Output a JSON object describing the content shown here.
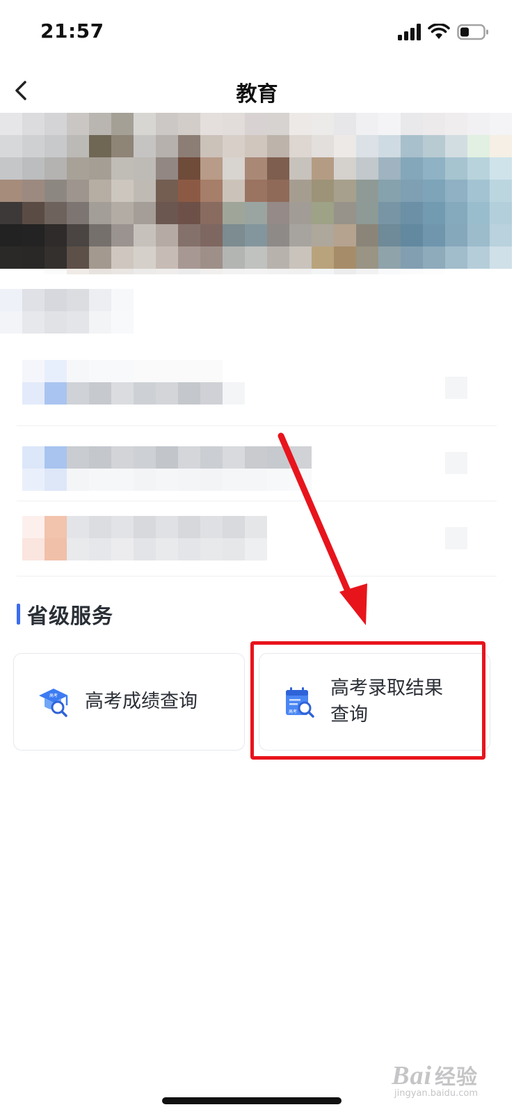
{
  "status_bar": {
    "time": "21:57",
    "icons": [
      "signal-icon",
      "wifi-icon",
      "battery-icon"
    ],
    "battery_level": 0.35
  },
  "nav": {
    "title": "教育",
    "back_icon": "chevron-left-icon"
  },
  "section": {
    "title": "省级服务",
    "accent_color": "#3c6cf0"
  },
  "services": [
    {
      "label": "高考成绩查询",
      "icon": "graduation-cap-search-icon",
      "icon_badge": "高考"
    },
    {
      "label_line1": "高考录取结果",
      "label_line2": "查询",
      "icon": "calendar-search-icon",
      "icon_badge": "高考"
    }
  ],
  "annotation": {
    "color": "#e8141c"
  },
  "watermark": {
    "logo": "Bai",
    "logo_suffix": "经验",
    "url": "jingyan.baidu.com"
  }
}
